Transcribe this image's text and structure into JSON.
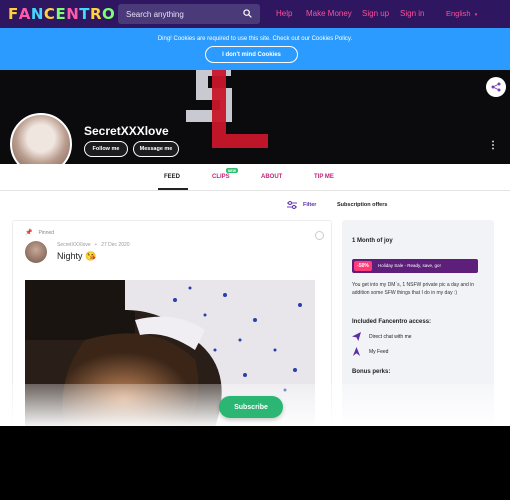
{
  "brand": {
    "logo": "FANCENTRO"
  },
  "nav": {
    "search_placeholder": "Search anything",
    "links": [
      "Help",
      "Make Money",
      "Sign up",
      "Sign in"
    ],
    "language": "English"
  },
  "cookie": {
    "message": "Ding! Cookies are required to use this site. Check out our Cookies Policy.",
    "button": "I don't mind Cookies"
  },
  "profile": {
    "name": "SecretXXXlove",
    "follow_label": "Follow me",
    "message_label": "Message me"
  },
  "tabs": [
    {
      "label": "FEED",
      "active": true
    },
    {
      "label": "CLIPS",
      "badge": "NEW"
    },
    {
      "label": "ABOUT"
    },
    {
      "label": "TIP ME"
    }
  ],
  "toolbar": {
    "filter": "Filter",
    "subscription_offers": "Subscription offers"
  },
  "post": {
    "pinned": "Pinned",
    "author": "SecretXXXlove",
    "date": "27 Dec 2020",
    "title": "Nighty 😘"
  },
  "offer": {
    "title": "1 Month of joy",
    "sale_pct": "-50%",
    "sale_text": "Holiday Sale - Ready, save, go!",
    "description": "You get into my DM`s, 1 NSFW private pic a day and in addition some SFW things that I do in my day :)",
    "included_heading": "Included Fancentro access:",
    "perks": [
      "Direct chat with me",
      "My Feed"
    ],
    "bonus_heading": "Bonus perks:"
  },
  "cta": {
    "subscribe": "Subscribe"
  },
  "colors": {
    "nav_bg": "#2e1760",
    "accent_pink": "#ff4f9a",
    "cookie_bg": "#2b9bff",
    "subscribe_green": "#2bb673"
  }
}
